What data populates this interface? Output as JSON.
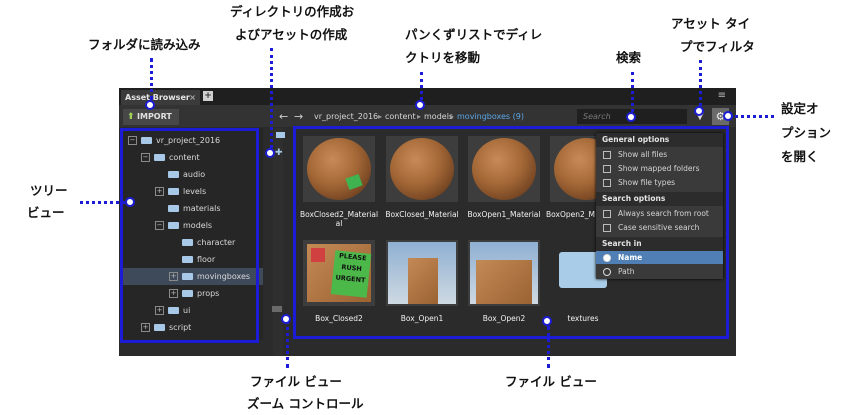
{
  "callouts": {
    "folder_import": "フォルダに読み込み",
    "create_dir_1": "ディレクトリの作成お",
    "create_dir_2": "よびアセットの作成",
    "breadcrumb_1": "パンくずリストでディレ",
    "breadcrumb_2": "クトリを移動",
    "search": "検索",
    "filter_1": "アセット タイ",
    "filter_2": "プでフィルタ",
    "settings_1": "設定オ",
    "settings_2": "プションを",
    "settings_3": "を開く",
    "tree_1": "ツリー",
    "tree_2": "ビュー",
    "zoom_1": "ファイル ビュー",
    "zoom_2": "ズーム コントロール",
    "file_view": "ファイル ビュー"
  },
  "window": {
    "tab_title": "Asset Browser",
    "tab_close": "×",
    "tab_add": "+",
    "menu_icon": "≡"
  },
  "toolbar": {
    "import_label": "IMPORT",
    "import_icon": "arrow-up-icon",
    "back": "←",
    "forward": "→",
    "breadcrumb": [
      "vr_project_2016",
      "content",
      "models",
      "movingboxes (9)"
    ],
    "breadcrumb_sep": "▸",
    "search_placeholder": "Search",
    "filter_icon": "funnel-icon",
    "settings_icon": "gear-icon"
  },
  "tree": {
    "items": [
      {
        "label": "vr_project_2016",
        "expander": "−"
      },
      {
        "label": "content",
        "expander": "−"
      },
      {
        "label": "audio",
        "expander": ""
      },
      {
        "label": "levels",
        "expander": "+"
      },
      {
        "label": "materials",
        "expander": ""
      },
      {
        "label": "models",
        "expander": "−"
      },
      {
        "label": "character",
        "expander": ""
      },
      {
        "label": "floor",
        "expander": ""
      },
      {
        "label": "movingboxes",
        "expander": "+"
      },
      {
        "label": "props",
        "expander": "+"
      },
      {
        "label": "ui",
        "expander": "+"
      },
      {
        "label": "script",
        "expander": "+"
      }
    ]
  },
  "files": {
    "items": [
      {
        "label": "BoxClosed2_Material",
        "label2": "al"
      },
      {
        "label": "BoxClosed_Material",
        "label2": ""
      },
      {
        "label": "BoxOpen1_Material",
        "label2": ""
      },
      {
        "label": "BoxOpen2_M",
        "label2": ""
      },
      {
        "label": "Box_Closed2",
        "label2": ""
      },
      {
        "label": "Box_Open1",
        "label2": ""
      },
      {
        "label": "Box_Open2",
        "label2": ""
      },
      {
        "label": "textures",
        "label2": ""
      }
    ],
    "sticker_text_1": "PLEASE",
    "sticker_text_2": "RUSH",
    "sticker_text_3": "URGENT"
  },
  "settings_menu": {
    "general_header": "General options",
    "general": [
      "Show all files",
      "Show mapped folders",
      "Show file types"
    ],
    "search_header": "Search options",
    "search": [
      "Always search from root",
      "Case sensitive search"
    ],
    "searchin_header": "Search in",
    "searchin": [
      "Name",
      "Path"
    ],
    "selected": "Name"
  },
  "colors": {
    "callout_blue": "#1c1cd6",
    "selection_blue": "#4f7fb5",
    "breadcrumb_active": "#5aa6e6",
    "import_green": "#9fd35a"
  }
}
